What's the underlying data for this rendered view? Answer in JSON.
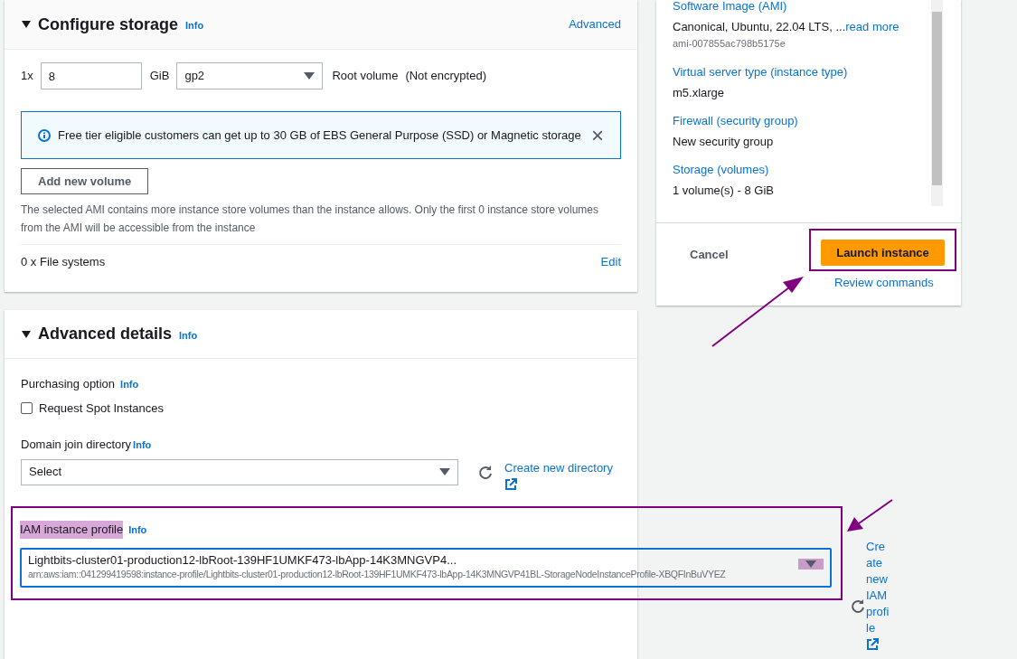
{
  "storage": {
    "title": "Configure storage",
    "expanded": true,
    "info": "Info",
    "advanced_link": "Advanced",
    "volume": {
      "count": "1x",
      "size": "8",
      "unit": "GiB",
      "type": "gp2",
      "label": "Root volume",
      "encryption": "(Not encrypted)"
    },
    "alert": {
      "text": "Free tier eligible customers can get up to 30 GB of EBS General Purpose (SSD) or Magnetic storage",
      "close": "×"
    },
    "add_button": "Add new volume",
    "note": "The selected AMI contains more instance store volumes than the instance allows. Only the first 0 instance store volumes from the AMI will be accessible from the instance",
    "file_systems": "0 x File systems",
    "edit_link": "Edit"
  },
  "summary": {
    "items": [
      {
        "label": "Software Image (AMI)",
        "value": "Canonical, Ubuntu, 22.04 LTS, ...",
        "link": "read more",
        "sub": "ami-007855ac798b5175e"
      },
      {
        "label": "Virtual server type (instance type)",
        "value": "m5.xlarge"
      },
      {
        "label": "Firewall (security group)",
        "value": "New security group"
      },
      {
        "label": "Storage (volumes)",
        "value": "1 volume(s) - 8 GiB"
      }
    ],
    "cancel": "Cancel",
    "launch": "Launch instance",
    "review": "Review commands"
  },
  "advanced": {
    "title": "Advanced details",
    "expanded": true,
    "info": "Info",
    "purchasing": {
      "label": "Purchasing option",
      "info": "Info",
      "checkbox": "Request Spot Instances",
      "checked": false
    },
    "domain": {
      "label": "Domain join directory",
      "info": "Info",
      "value": "Select",
      "link": "Create new directory"
    },
    "iam": {
      "label": "IAM instance profile",
      "info": "Info",
      "value": "Lightbits-cluster01-production12-lbRoot-139HF1UMKF473-lbApp-14K3MNGVP4...",
      "arn": "arn:aws:iam::041299419598:instance-profile/Lightbits-cluster01-production12-lbRoot-139HF1UMKF473-lbApp-14K3MNGVP41BL-StorageNodeInstanceProfile-XBQFInBuVYEZ",
      "link": "Create new IAM profile"
    }
  }
}
